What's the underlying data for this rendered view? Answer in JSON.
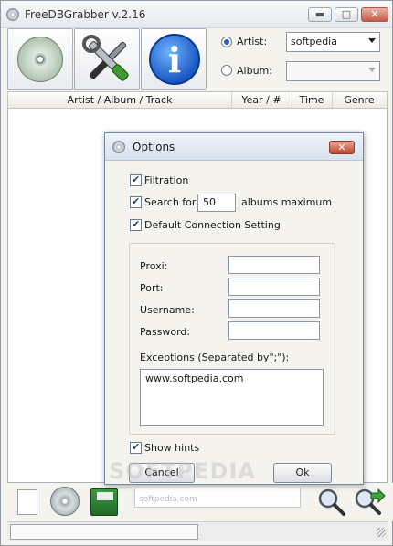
{
  "window": {
    "title": "FreeDBGrabber v.2.16",
    "controls": {
      "minimize": "▬",
      "maximize": "□",
      "close": "✕"
    }
  },
  "toolbar": {
    "icons": [
      "cd-icon",
      "tools-icon",
      "info-icon"
    ],
    "info_glyph": "i",
    "artist_label": "Artist:",
    "artist_value": "softpedia",
    "album_label": "Album:",
    "album_value": "",
    "search_by": "artist"
  },
  "columns": [
    "Artist / Album / Track",
    "Year / #",
    "Time",
    "Genre"
  ],
  "options_dialog": {
    "title": "Options",
    "close_glyph": "✕",
    "filtration_label": "Filtration",
    "filtration_checked": true,
    "search_for_label": "Search for",
    "search_for_value": "50",
    "albums_maximum_label": "albums maximum",
    "search_for_checked": true,
    "default_connection_label": "Default Connection Setting",
    "default_connection_checked": true,
    "proxi_label": "Proxi:",
    "proxi_value": "",
    "port_label": "Port:",
    "port_value": "",
    "username_label": "Username:",
    "username_value": "",
    "password_label": "Password:",
    "password_value": "",
    "exceptions_label": "Exceptions (Separated by\";\"):",
    "exceptions_value": "www.softpedia.com",
    "show_hints_label": "Show hints",
    "show_hints_checked": true,
    "cancel_label": "Cancel",
    "ok_label": "Ok"
  },
  "bottombar": {
    "search_value": "softpedia.com",
    "icons": [
      "new-document-icon",
      "cd-add-icon",
      "save-icon",
      "search-icon",
      "search-next-icon"
    ]
  },
  "watermark": "SOFTPEDIA"
}
